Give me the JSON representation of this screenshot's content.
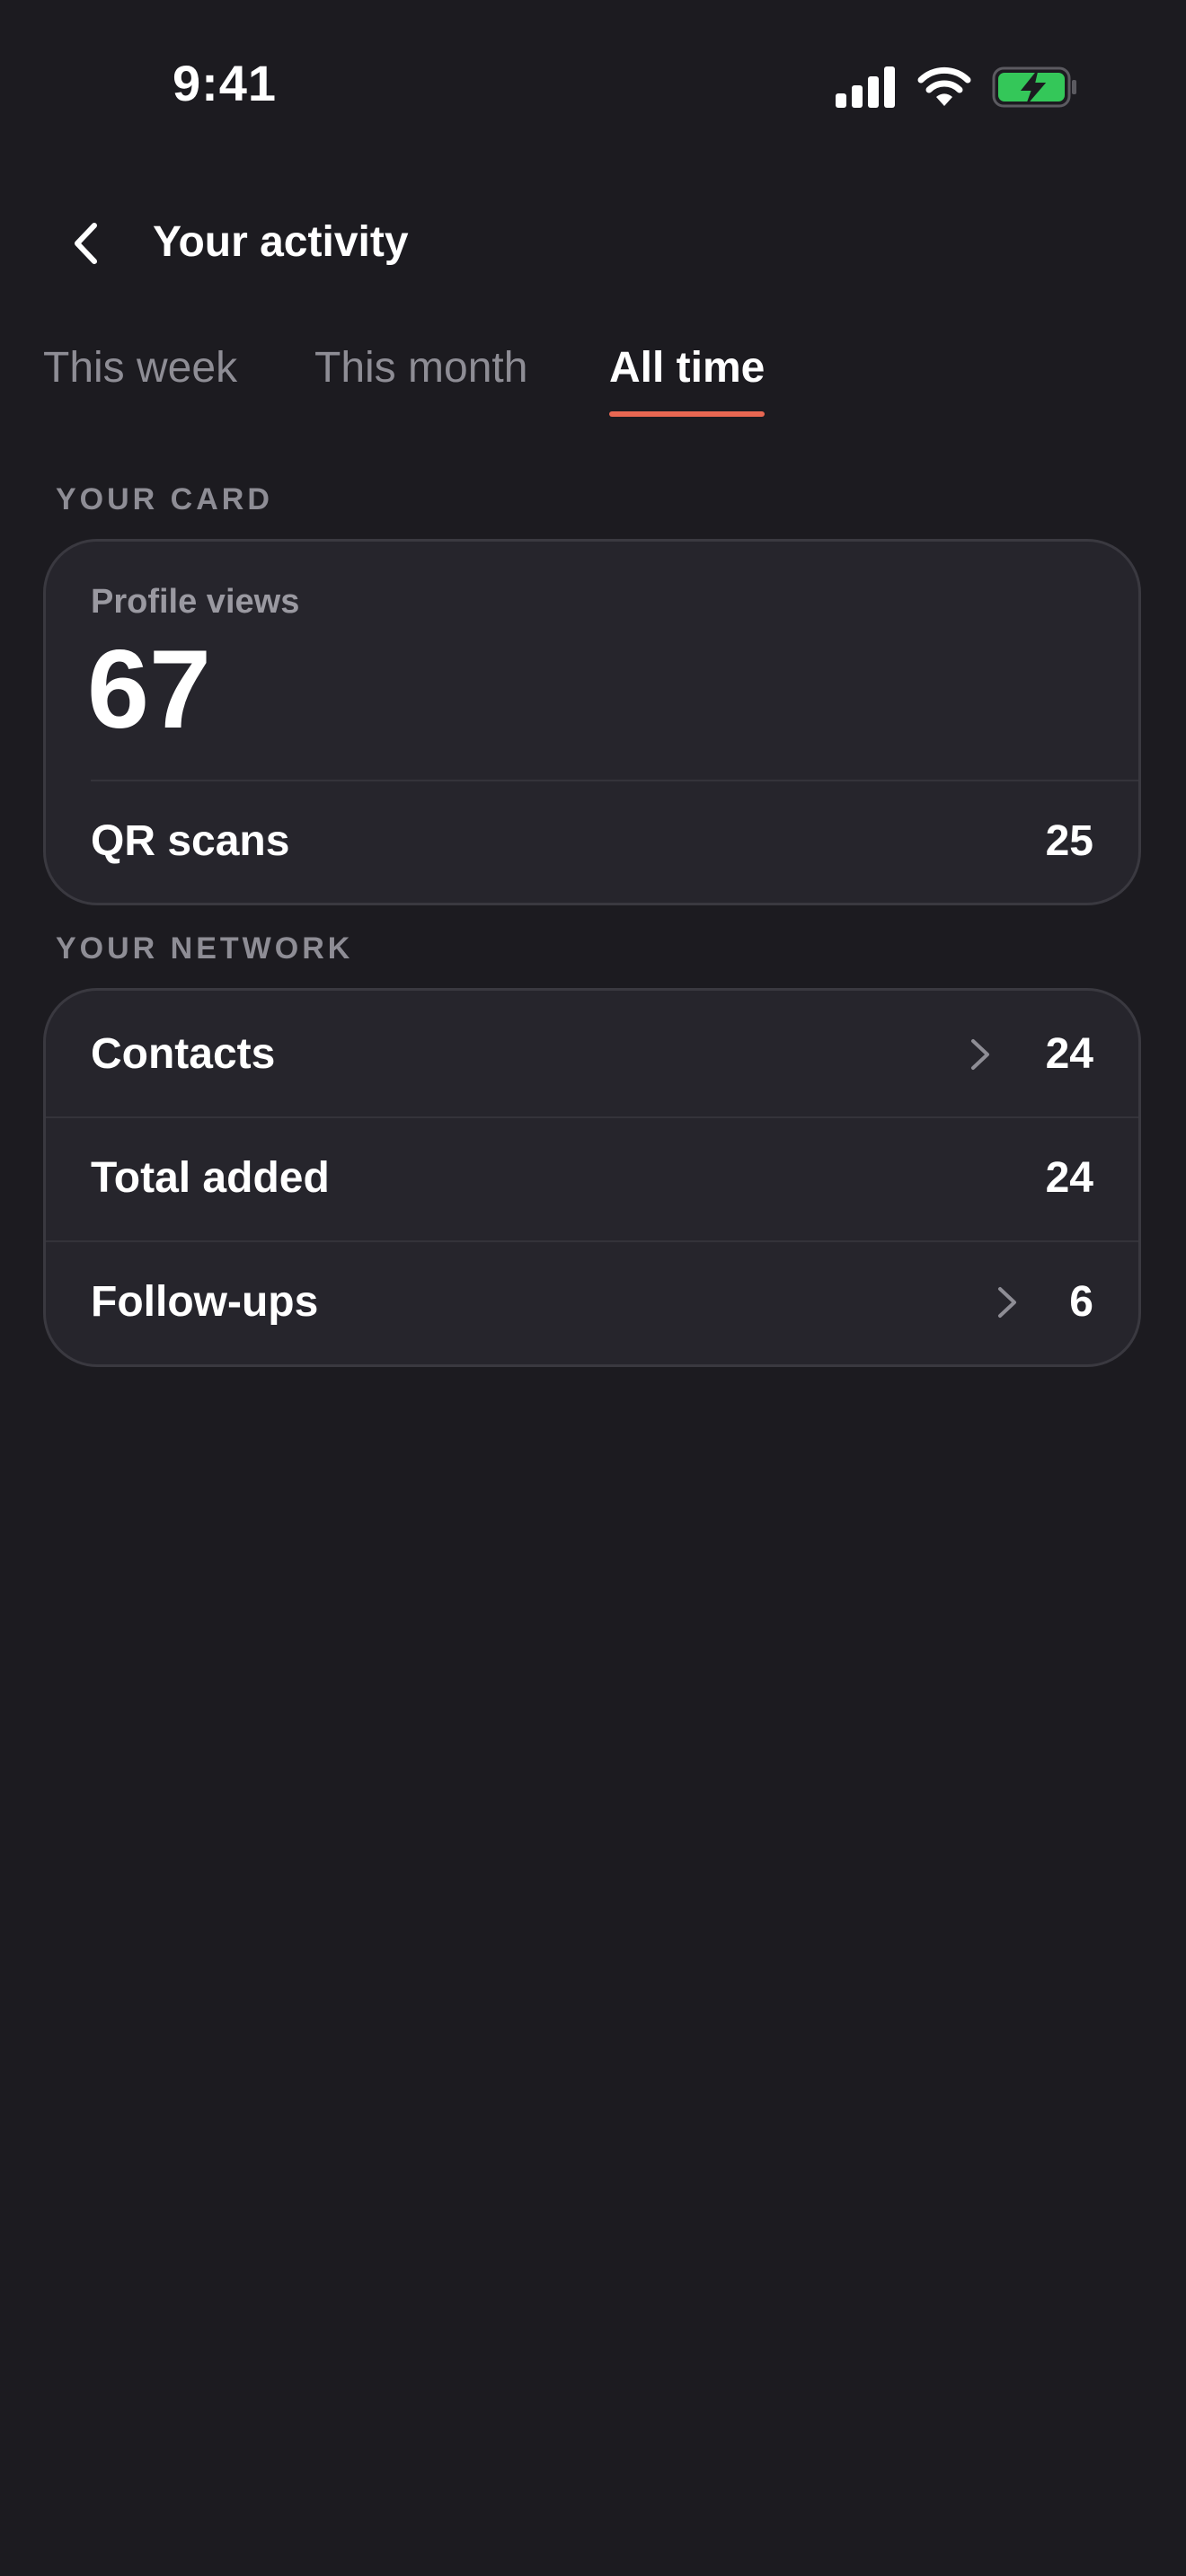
{
  "status_bar": {
    "time": "9:41",
    "icons": [
      "cellular-signal-icon",
      "wifi-icon",
      "battery-charging-icon"
    ],
    "battery_color": "#34c759"
  },
  "header": {
    "back_icon": "chevron-left-icon",
    "title": "Your activity"
  },
  "tabs": [
    {
      "label": "This week",
      "active": false
    },
    {
      "label": "This month",
      "active": false
    },
    {
      "label": "All time",
      "active": true
    }
  ],
  "accent_color": "#e86752",
  "your_card": {
    "section_label": "YOUR CARD",
    "profile_views_label": "Profile views",
    "profile_views_value": "67",
    "rows": [
      {
        "label": "QR scans",
        "value": "25",
        "chevron": false
      }
    ]
  },
  "your_network": {
    "section_label": "YOUR NETWORK",
    "rows": [
      {
        "label": "Contacts",
        "value": "24",
        "chevron": true
      },
      {
        "label": "Total added",
        "value": "24",
        "chevron": false
      },
      {
        "label": "Follow-ups",
        "value": "6",
        "chevron": true
      }
    ]
  }
}
